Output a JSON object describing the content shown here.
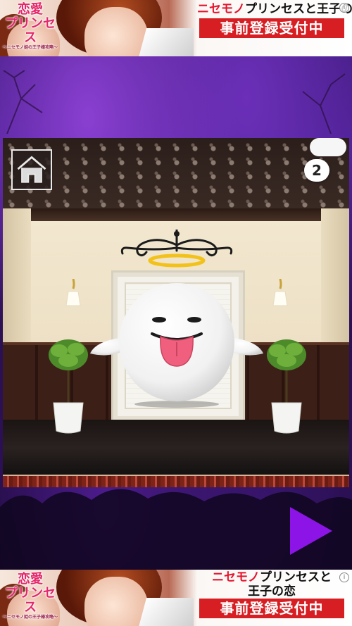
{
  "ad_top": {
    "logo_line1": "恋愛",
    "logo_line2": "プリンセス",
    "logo_sub": "～ニセモノ姫の王子様攻略～",
    "headline_highlight": "ニセモノ",
    "headline_rest": "プリンセスと",
    "headline_line2": "王子の恋",
    "cta": "事前登録受付中",
    "info_icon": "info-icon"
  },
  "ad_bottom": {
    "logo_line1": "恋愛",
    "logo_line2": "プリンセス",
    "logo_sub": "～ニセモノ姫の王子様攻略～",
    "headline_highlight": "ニセモノ",
    "headline_rest": "プリンセスと",
    "headline_line2": "王子の恋",
    "cta": "事前登録受付中",
    "info_icon": "info-icon"
  },
  "game": {
    "home_icon": "house-icon",
    "item_count": "2",
    "next_icon": "play-triangle-icon",
    "colors": {
      "sky": "#3d1a7a",
      "next_button": "#8d14e6",
      "tongue": "#f0607e"
    }
  }
}
